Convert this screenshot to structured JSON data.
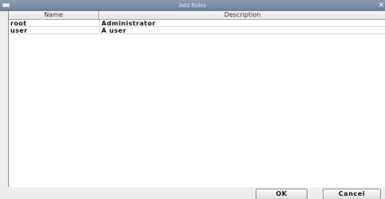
{
  "window": {
    "title": "Add Roles",
    "close_glyph": "×"
  },
  "table": {
    "columns": [
      "Name",
      "Description"
    ],
    "rows": [
      {
        "name": "root",
        "description": "Administrator"
      },
      {
        "name": "user",
        "description": "A user"
      }
    ]
  },
  "buttons": {
    "ok_label": "OK",
    "cancel_label": "Cancel"
  },
  "colors": {
    "titlebar": "#7b8ca8",
    "window_bg": "#eeeeee",
    "table_bg": "#ffffff"
  }
}
